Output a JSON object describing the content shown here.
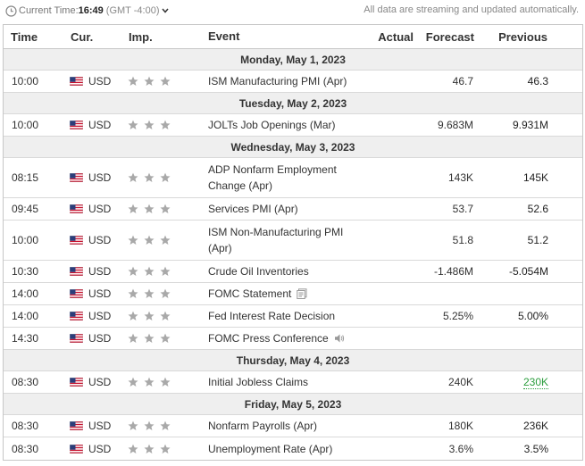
{
  "header": {
    "time_label": "Current Time:",
    "time_value": "16:49",
    "timezone": "(GMT -4:00)",
    "stream_note": "All data are streaming and updated automatically."
  },
  "columns": {
    "time": "Time",
    "currency": "Cur.",
    "importance": "Imp.",
    "event": "Event",
    "actual": "Actual",
    "forecast": "Forecast",
    "previous": "Previous"
  },
  "colors": {
    "star_gray": "#a9a9a9",
    "previous_better": "#2a9d3c",
    "day_row_bg": "#efefef"
  },
  "icons": {
    "clock": "clock-icon",
    "chevron": "chevron-down-icon",
    "flag": "us-flag-icon",
    "star": "star-icon",
    "report": "report-icon",
    "speaker": "speaker-icon"
  },
  "days": [
    {
      "label": "Monday, May 1, 2023",
      "events": [
        {
          "time": "10:00",
          "currency": "USD",
          "importance": 3,
          "event": "ISM Manufacturing PMI (Apr)",
          "actual": "",
          "forecast": "46.7",
          "previous": "46.3",
          "lines": 1
        }
      ]
    },
    {
      "label": "Tuesday, May 2, 2023",
      "events": [
        {
          "time": "10:00",
          "currency": "USD",
          "importance": 3,
          "event": "JOLTs Job Openings (Mar)",
          "actual": "",
          "forecast": "9.683M",
          "previous": "9.931M",
          "lines": 1
        }
      ]
    },
    {
      "label": "Wednesday, May 3, 2023",
      "events": [
        {
          "time": "08:15",
          "currency": "USD",
          "importance": 3,
          "event": "ADP Nonfarm Employment Change (Apr)",
          "actual": "",
          "forecast": "143K",
          "previous": "145K",
          "lines": 2
        },
        {
          "time": "09:45",
          "currency": "USD",
          "importance": 3,
          "event": "Services PMI (Apr)",
          "actual": "",
          "forecast": "53.7",
          "previous": "52.6",
          "lines": 1
        },
        {
          "time": "10:00",
          "currency": "USD",
          "importance": 3,
          "event": "ISM Non-Manufacturing PMI (Apr)",
          "actual": "",
          "forecast": "51.8",
          "previous": "51.2",
          "lines": 2
        },
        {
          "time": "10:30",
          "currency": "USD",
          "importance": 3,
          "event": "Crude Oil Inventories",
          "actual": "",
          "forecast": "-1.486M",
          "previous": "-5.054M",
          "lines": 1
        },
        {
          "time": "14:00",
          "currency": "USD",
          "importance": 3,
          "event": "FOMC Statement",
          "actual": "",
          "forecast": "",
          "previous": "",
          "lines": 1,
          "icon": "report"
        },
        {
          "time": "14:00",
          "currency": "USD",
          "importance": 3,
          "event": "Fed Interest Rate Decision",
          "actual": "",
          "forecast": "5.25%",
          "previous": "5.00%",
          "lines": 1
        },
        {
          "time": "14:30",
          "currency": "USD",
          "importance": 3,
          "event": "FOMC Press Conference",
          "actual": "",
          "forecast": "",
          "previous": "",
          "lines": 1,
          "icon": "speaker"
        }
      ]
    },
    {
      "label": "Thursday, May 4, 2023",
      "events": [
        {
          "time": "08:30",
          "currency": "USD",
          "importance": 3,
          "event": "Initial Jobless Claims",
          "actual": "",
          "forecast": "240K",
          "previous": "230K",
          "lines": 1,
          "previous_style": "green"
        }
      ]
    },
    {
      "label": "Friday, May 5, 2023",
      "events": [
        {
          "time": "08:30",
          "currency": "USD",
          "importance": 3,
          "event": "Nonfarm Payrolls (Apr)",
          "actual": "",
          "forecast": "180K",
          "previous": "236K",
          "lines": 1
        },
        {
          "time": "08:30",
          "currency": "USD",
          "importance": 3,
          "event": "Unemployment Rate (Apr)",
          "actual": "",
          "forecast": "3.6%",
          "previous": "3.5%",
          "lines": 1
        }
      ]
    }
  ]
}
